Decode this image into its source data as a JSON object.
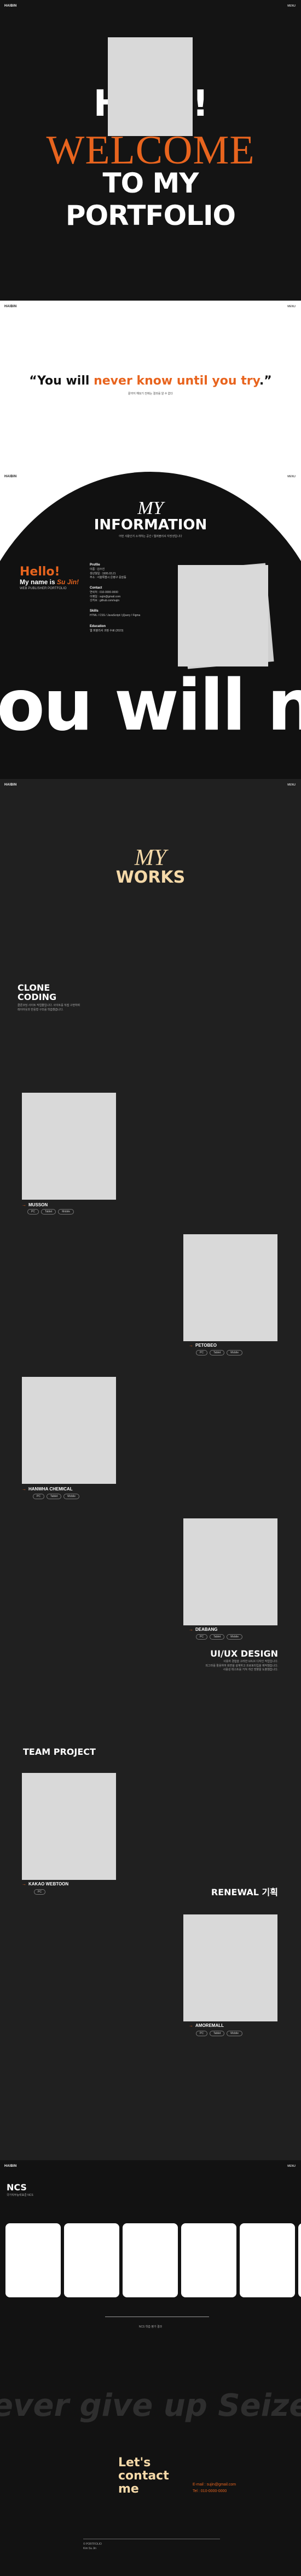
{
  "header": {
    "logo": "HAIBIN",
    "menu": "MENU"
  },
  "hero": {
    "hello": "Hello!",
    "welcome": "WELCOME",
    "to_my": "TO MY",
    "portfolio": "PORTFOLIO"
  },
  "quote": {
    "open": "“You will ",
    "highlight": "never know until you try",
    "close": ".”",
    "sub": "끝까지 해보기 전에는 결과를 알 수 없다"
  },
  "info": {
    "my": "MY",
    "title": "INFORMATION",
    "subtitle": "어떤 사람인지 소개하는 공간 / 웹퍼블리셔 지망생입니다",
    "hello": "Hello!",
    "name_prefix": "My name is ",
    "name_value": "Su Jin!",
    "tagline": "WEB PUBLISHER PORTFOLIO",
    "profile_title": "Profile",
    "profile_lines": [
      "이름 : 김수진",
      "생년월일 : 1995.03.21",
      "주소 : 서울특별시 은평구 응암동"
    ],
    "contact_title": "Contact",
    "contact_lines": [
      "연락처 : 010-0000-0000",
      "이메일 : sujin@gmail.com",
      "깃허브 : github.com/sujin"
    ],
    "skill_title": "Skills",
    "skill_lines": [
      "HTML / CSS / JavaScript / jQuery / Figma"
    ],
    "edu_title": "Education",
    "edu_lines": [
      "웹 퍼블리셔 과정 수료 (2023)"
    ],
    "marquee": "ou will ne"
  },
  "works": {
    "my": "MY",
    "title": "WORKS",
    "clone_title_1": "CLONE",
    "clone_title_2": "CODING",
    "clone_desc_1": "클론코딩 사이트 작업물입니다. 사이트를 직접 구현하며",
    "clone_desc_2": "레이아웃과 반응형 구조를 학습했습니다.",
    "projects": [
      {
        "name": "MUSSON",
        "tags": [
          "PC",
          "Tablet",
          "Mobile"
        ]
      },
      {
        "name": "PETOBEO",
        "tags": [
          "PC",
          "Tablet",
          "Mobile"
        ]
      },
      {
        "name": "HANWHA CHEMICAL",
        "tags": [
          "PC",
          "Tablet",
          "Mobile"
        ]
      },
      {
        "name": "DEABANG",
        "tags": [
          "PC",
          "Tablet",
          "Mobile"
        ]
      }
    ],
    "uiux_title": "UI/UX DESIGN",
    "uiux_desc_1": "사용자 경험을 고려한 UI/UX 디자인 작업입니다.",
    "uiux_desc_2": "피그마를 활용하여 화면을 설계하고 프로토타입을 제작했습니다.",
    "uiux_desc_3": "사용성 테스트를 거쳐 개선 방향을 도출했습니다.",
    "team_title": "TEAM PROJECT",
    "team_project": {
      "name": "KAKAO WEBTOON",
      "tags": [
        "PC"
      ]
    },
    "renewal_title": "RENEWAL 기획",
    "renewal_project": {
      "name": "AMOREMALL",
      "tags": [
        "PC",
        "Tablet",
        "Mobile"
      ]
    }
  },
  "ncs": {
    "title": "NCS",
    "subtitle": "국가직무능력표준 NCS",
    "caption": "NCS 학습 평가 결과",
    "marquee": "ever give up Seize f",
    "contact_1": "Let's",
    "contact_2": "contact",
    "contact_3": "me",
    "email": "E-mail : sujin@gmail.com",
    "tel": "Tel : 010-0000-0000",
    "footer_1": "© PORTFOLIO",
    "footer_2": "Kim Su Jin"
  },
  "colors": {
    "accent": "#e8641e",
    "cream": "#f5d9a8",
    "dark": "#121212"
  }
}
